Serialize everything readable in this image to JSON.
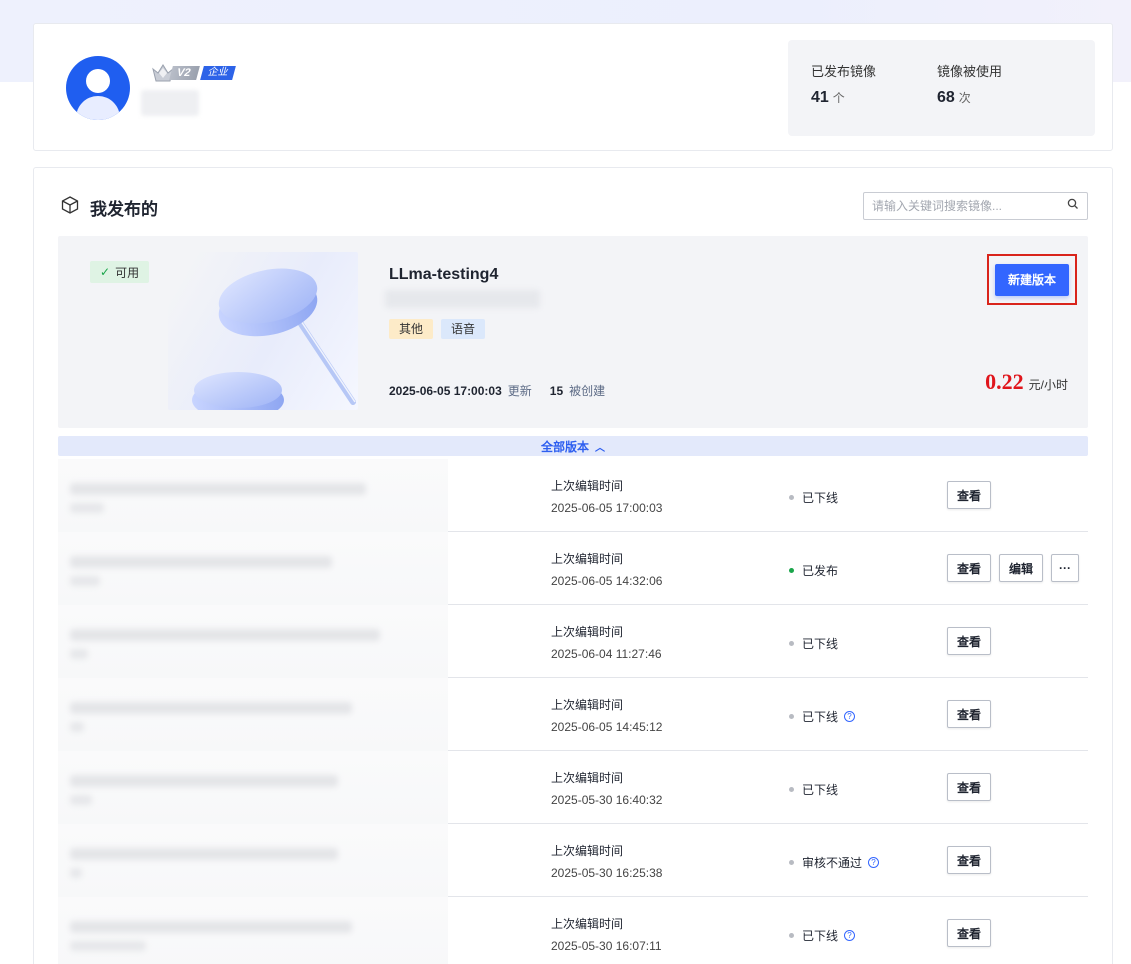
{
  "profile": {
    "level": "V2",
    "enterprise_tag": "企业",
    "stats": [
      {
        "label": "已发布镜像",
        "value": "41",
        "unit": "个"
      },
      {
        "label": "镜像被使用",
        "value": "68",
        "unit": "次"
      }
    ]
  },
  "section": {
    "title": "我发布的",
    "search_placeholder": "请输入关键词搜索镜像..."
  },
  "image": {
    "status": "可用",
    "name": "LLma-testing4",
    "tags": [
      "其他",
      "语音"
    ],
    "updated_at": "2025-06-05 17:00:03",
    "updated_label": "更新",
    "created_count": "15",
    "created_label": "被创建",
    "new_version_label": "新建版本",
    "price": "0.22",
    "price_unit": "元/小时"
  },
  "all_versions_label": "全部版本",
  "versions": [
    {
      "edit_label": "上次编辑时间",
      "time": "2025-06-05 17:00:03",
      "status": "已下线",
      "status_color": "#b8bbc2",
      "help": false,
      "actions": [
        "查看"
      ]
    },
    {
      "edit_label": "上次编辑时间",
      "time": "2025-06-05 14:32:06",
      "status": "已发布",
      "status_color": "#1aa54a",
      "help": false,
      "actions": [
        "查看",
        "编辑",
        "···"
      ]
    },
    {
      "edit_label": "上次编辑时间",
      "time": "2025-06-04 11:27:46",
      "status": "已下线",
      "status_color": "#b8bbc2",
      "help": false,
      "actions": [
        "查看"
      ]
    },
    {
      "edit_label": "上次编辑时间",
      "time": "2025-06-05 14:45:12",
      "status": "已下线",
      "status_color": "#b8bbc2",
      "help": true,
      "actions": [
        "查看"
      ]
    },
    {
      "edit_label": "上次编辑时间",
      "time": "2025-05-30 16:40:32",
      "status": "已下线",
      "status_color": "#b8bbc2",
      "help": false,
      "actions": [
        "查看"
      ]
    },
    {
      "edit_label": "上次编辑时间",
      "time": "2025-05-30 16:25:38",
      "status": "审核不通过",
      "status_color": "#b8bbc2",
      "help": true,
      "actions": [
        "查看"
      ]
    },
    {
      "edit_label": "上次编辑时间",
      "time": "2025-05-30 16:07:11",
      "status": "已下线",
      "status_color": "#b8bbc2",
      "help": true,
      "actions": [
        "查看"
      ]
    }
  ]
}
